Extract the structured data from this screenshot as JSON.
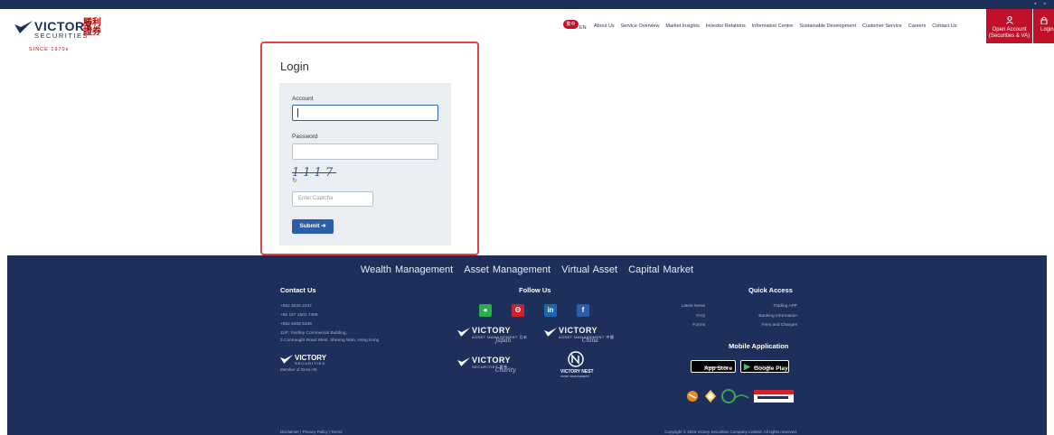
{
  "header": {
    "logo_text": "VICTORY",
    "logo_sub": "SECURITIES",
    "logo_cn": "勝利證券",
    "logo_since": "SINCE 1970s",
    "lang_badge": "繁中",
    "lang_label": "EN",
    "nav": [
      "About Us",
      "Service Overview",
      "Market Insights",
      "Investor Relations",
      "Information Centre",
      "Sustainable Development",
      "Customer Service",
      "Careers",
      "Contact Us"
    ],
    "open_account": "Open Account (Securities & VA)",
    "login": "Login"
  },
  "login": {
    "title": "Login",
    "account_label": "Account",
    "account_value": "",
    "password_label": "Password",
    "password_value": "",
    "captcha_text": "1117",
    "refresh_icon": "↻",
    "captcha_placeholder": "Enter Captcha",
    "submit_label": "Submit ➔"
  },
  "footer": {
    "businesses": [
      "Wealth Management",
      "Asset Management",
      "Virtual Asset",
      "Capital Market"
    ],
    "contact_title": "Contact Us",
    "contact_lines": [
      "+852 2525 2437",
      "+86 197 1501 7408",
      "+852 5408 5438"
    ],
    "address_1": "11/F, Yardley Commercial Building,",
    "address_2": "3 Connaught Road West, Sheung Wan, Hong Kong",
    "member_text": "Member of IDAS.HK",
    "follow_title": "Follow Us",
    "social": [
      "wechat",
      "weibo",
      "in",
      "f"
    ],
    "brands": [
      {
        "name": "VICTORY",
        "sub": "ASSET MANAGEMENT 日本",
        "script": "Japan"
      },
      {
        "name": "VICTORY",
        "sub": "ASSET MANAGEMENT 中國",
        "script": "China"
      },
      {
        "name": "VICTORY",
        "sub": "SECURITIES 證券",
        "script": "Charity"
      },
      {
        "name": "VICTORY NEST",
        "sub": "ASSET MANAGEMENT",
        "script": ""
      }
    ],
    "quick_title": "Quick Access",
    "quick_left": [
      "Latest News",
      "FAQ",
      "Forms"
    ],
    "quick_right": [
      "Trading APP",
      "Banking Information",
      "Fees and Charges"
    ],
    "mobile_title": "Mobile Application",
    "app_store_small": "Download on the",
    "app_store": "App Store",
    "google_play_small": "GET IT ON",
    "google_play": "Google Play",
    "bottom_links": "Disclaimer  |  Privacy Policy  |  Terms",
    "copyright": "Copyright © 2025 Victory Securities Company Limited. All rights reserved."
  },
  "colors": {
    "navy": "#1e2f5c",
    "red": "#c0102a",
    "focus_blue": "#2b63b0",
    "highlight": "#e24444"
  }
}
